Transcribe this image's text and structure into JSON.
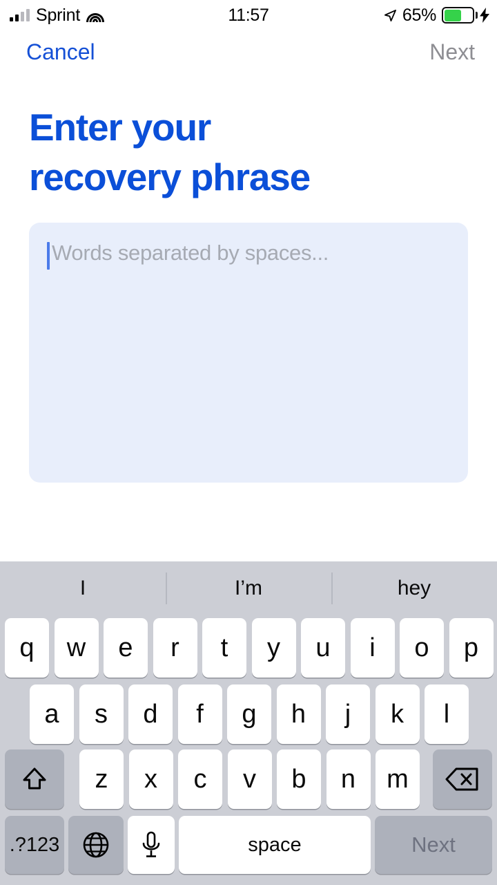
{
  "status_bar": {
    "carrier": "Sprint",
    "time": "11:57",
    "battery_percent": "65%",
    "signal_icon": "cellular-signal-icon",
    "wifi_icon": "wifi-icon",
    "location_icon": "location-arrow-icon",
    "battery_icon": "battery-icon",
    "charging_icon": "lightning-bolt-icon",
    "battery_fill_color": "#35d24a",
    "signal_bars_filled": 2,
    "signal_bars_total": 4
  },
  "nav_bar": {
    "cancel_label": "Cancel",
    "next_label": "Next",
    "cancel_color": "#1550d6",
    "next_color": "#8e8e93"
  },
  "content": {
    "heading_line1": "Enter your",
    "heading_line2": "recovery phrase",
    "heading_color": "#0b4fd8",
    "input_placeholder": "Words separated by spaces...",
    "input_value": "",
    "input_background": "#e8eefb",
    "caret_color": "#4b7bea"
  },
  "keyboard": {
    "background": "#ccced5",
    "suggestions": [
      "I",
      "I’m",
      "hey"
    ],
    "row1": [
      "q",
      "w",
      "e",
      "r",
      "t",
      "y",
      "u",
      "i",
      "o",
      "p"
    ],
    "row2": [
      "a",
      "s",
      "d",
      "f",
      "g",
      "h",
      "j",
      "k",
      "l"
    ],
    "row3": [
      "z",
      "x",
      "c",
      "v",
      "b",
      "n",
      "m"
    ],
    "shift_icon": "shift-arrow-icon",
    "backspace_icon": "backspace-delete-icon",
    "numeric_label": ".?123",
    "globe_icon": "globe-language-icon",
    "mic_icon": "microphone-icon",
    "space_label": "space",
    "return_label": "Next"
  }
}
